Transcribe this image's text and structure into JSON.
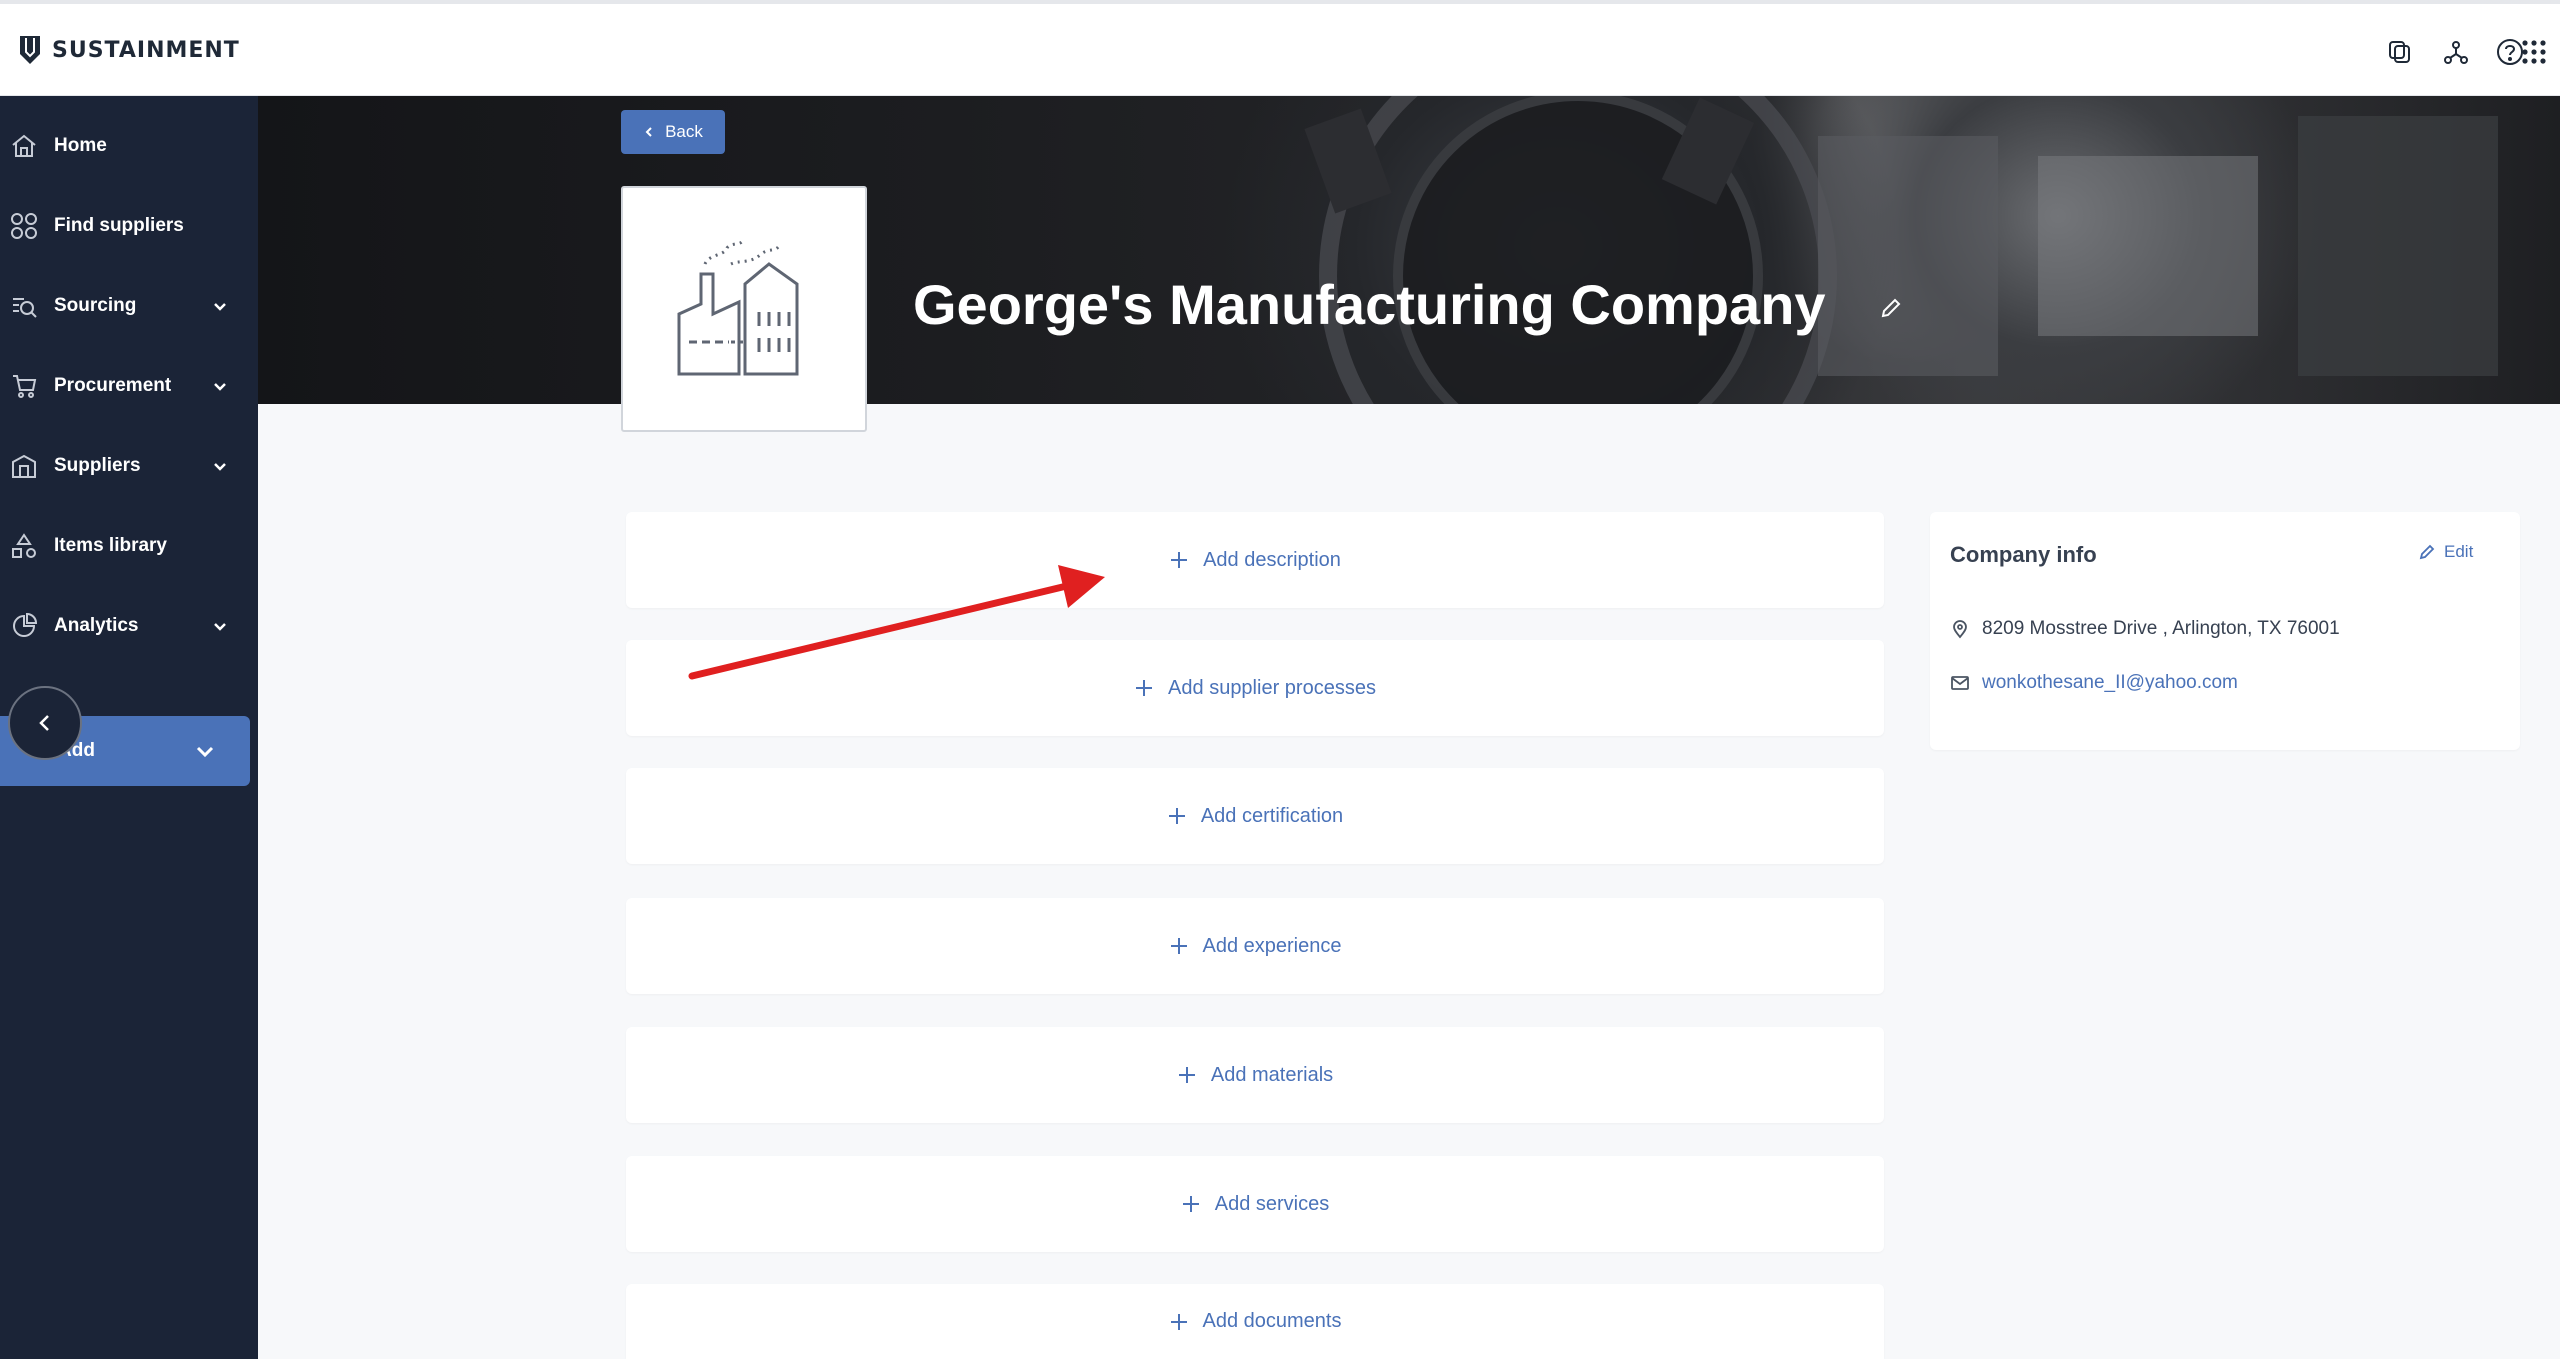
{
  "app": {
    "brand": "SUSTAINMENT"
  },
  "topbar": {
    "icons": [
      "copy-icon",
      "network-icon",
      "help-icon",
      "apps-grid-icon"
    ]
  },
  "sidebar": {
    "items": [
      {
        "label": "Home",
        "icon": "home-icon",
        "has_chevron": false
      },
      {
        "label": "Find suppliers",
        "icon": "find-suppliers-icon",
        "has_chevron": false
      },
      {
        "label": "Sourcing",
        "icon": "sourcing-icon",
        "has_chevron": true
      },
      {
        "label": "Procurement",
        "icon": "cart-icon",
        "has_chevron": true
      },
      {
        "label": "Suppliers",
        "icon": "building-icon",
        "has_chevron": true
      },
      {
        "label": "Items library",
        "icon": "shapes-icon",
        "has_chevron": false
      },
      {
        "label": "Analytics",
        "icon": "chart-icon",
        "has_chevron": true
      }
    ],
    "add_button": {
      "label": "Add"
    }
  },
  "header": {
    "back_label": "Back",
    "company_name": "George's Manufacturing Company"
  },
  "sections": [
    {
      "label": "Add description"
    },
    {
      "label": "Add supplier processes"
    },
    {
      "label": "Add certification"
    },
    {
      "label": "Add experience"
    },
    {
      "label": "Add materials"
    },
    {
      "label": "Add services"
    },
    {
      "label": "Add documents"
    }
  ],
  "company_info": {
    "title": "Company info",
    "edit_label": "Edit",
    "address": "8209 Mosstree Drive , Arlington, TX 76001",
    "email": "wonkothesane_II@yahoo.com"
  },
  "colors": {
    "accent": "#4a72b8",
    "sidebar_bg": "#1b2437",
    "annotation_arrow": "#e02020"
  }
}
